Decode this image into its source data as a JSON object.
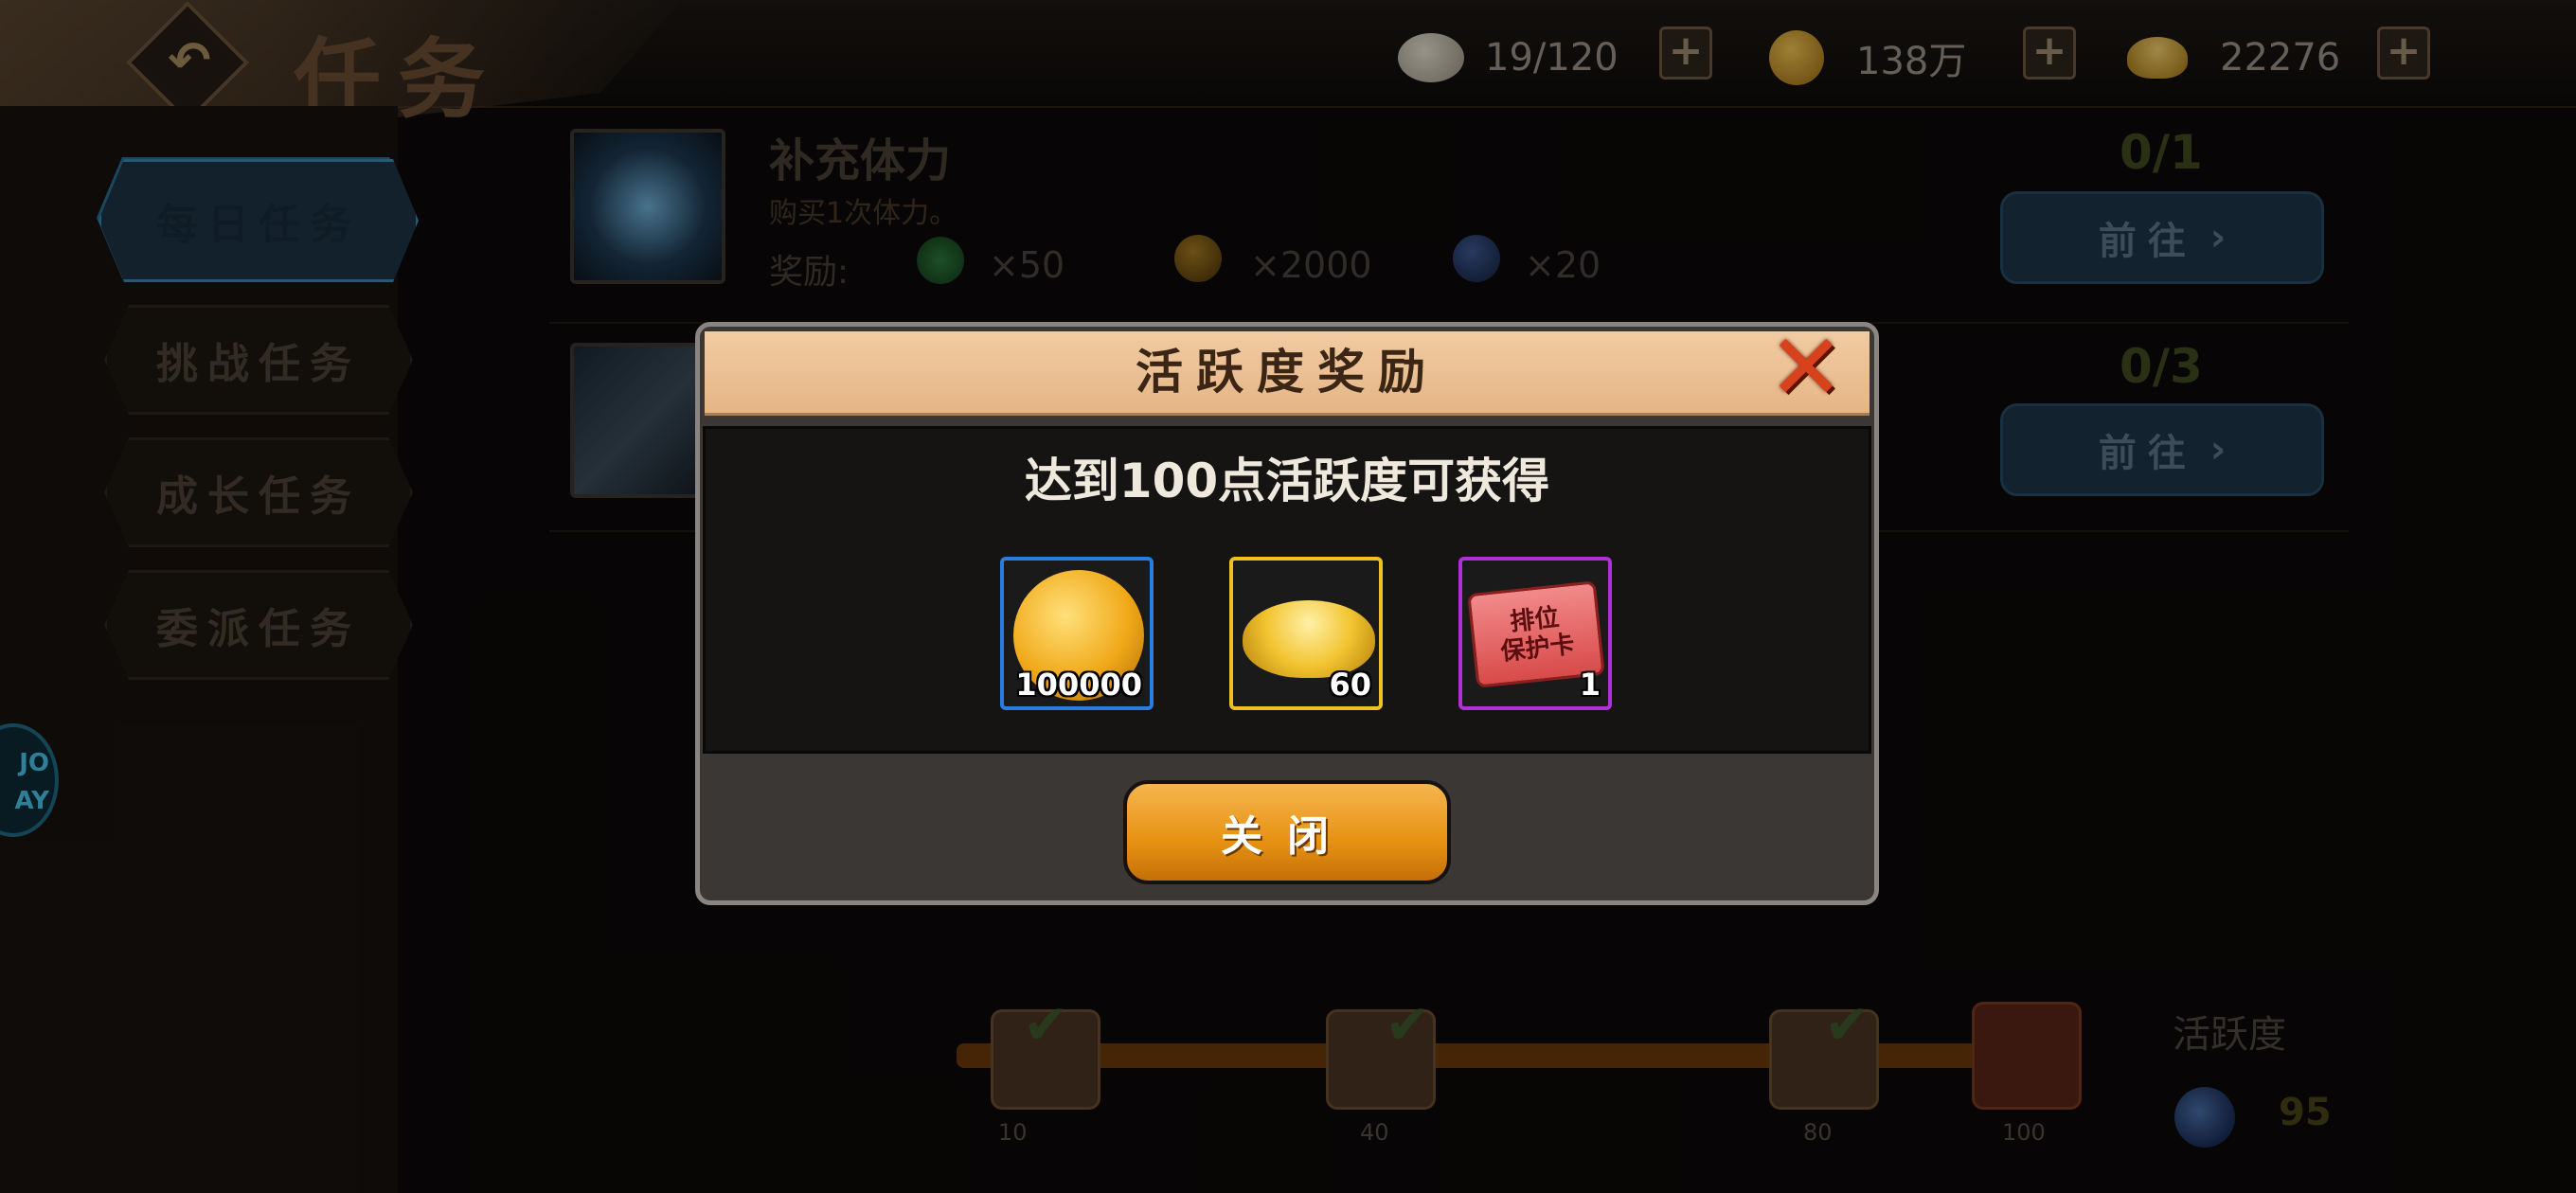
{
  "header": {
    "title": "任务",
    "resources": [
      {
        "icon": "stamina-bun-icon",
        "value": "19/120"
      },
      {
        "icon": "gold-coin-icon",
        "value": "138万"
      },
      {
        "icon": "gold-ingot-icon",
        "value": "22276"
      }
    ],
    "plus_label": "+"
  },
  "sidebar": {
    "items": [
      {
        "label": "每日任务",
        "active": true
      },
      {
        "label": "挑战任务",
        "active": false
      },
      {
        "label": "成长任务",
        "active": false
      },
      {
        "label": "委派任务",
        "active": false
      }
    ]
  },
  "tasks": [
    {
      "title": "补充体力",
      "desc": "购买1次体力。",
      "reward_label": "奖励:",
      "rewards": [
        {
          "icon": "exp-icon",
          "amount": "×50"
        },
        {
          "icon": "gold-coin-icon",
          "amount": "×2000"
        },
        {
          "icon": "activity-orb-icon",
          "amount": "×20"
        }
      ],
      "progress": "0/1",
      "button": "前往"
    },
    {
      "title": "",
      "desc": "",
      "progress": "0/3",
      "button": "前往"
    }
  ],
  "activity": {
    "label": "活跃度",
    "value": "95",
    "milestones": [
      "10",
      "40",
      "80",
      "100"
    ]
  },
  "side_widget": "JO\nAY",
  "modal": {
    "title": "活跃度奖励",
    "description": "达到100点活跃度可获得",
    "rewards": [
      {
        "name": "gold-coin",
        "count": "100000",
        "border": "#2a7de0"
      },
      {
        "name": "gold-ingot",
        "count": "60",
        "border": "#f0c020"
      },
      {
        "name": "rank-protection-card",
        "count": "1",
        "border": "#b030d8",
        "card_text_1": "排位",
        "card_text_2": "保护卡"
      }
    ],
    "close_button": "关闭"
  }
}
